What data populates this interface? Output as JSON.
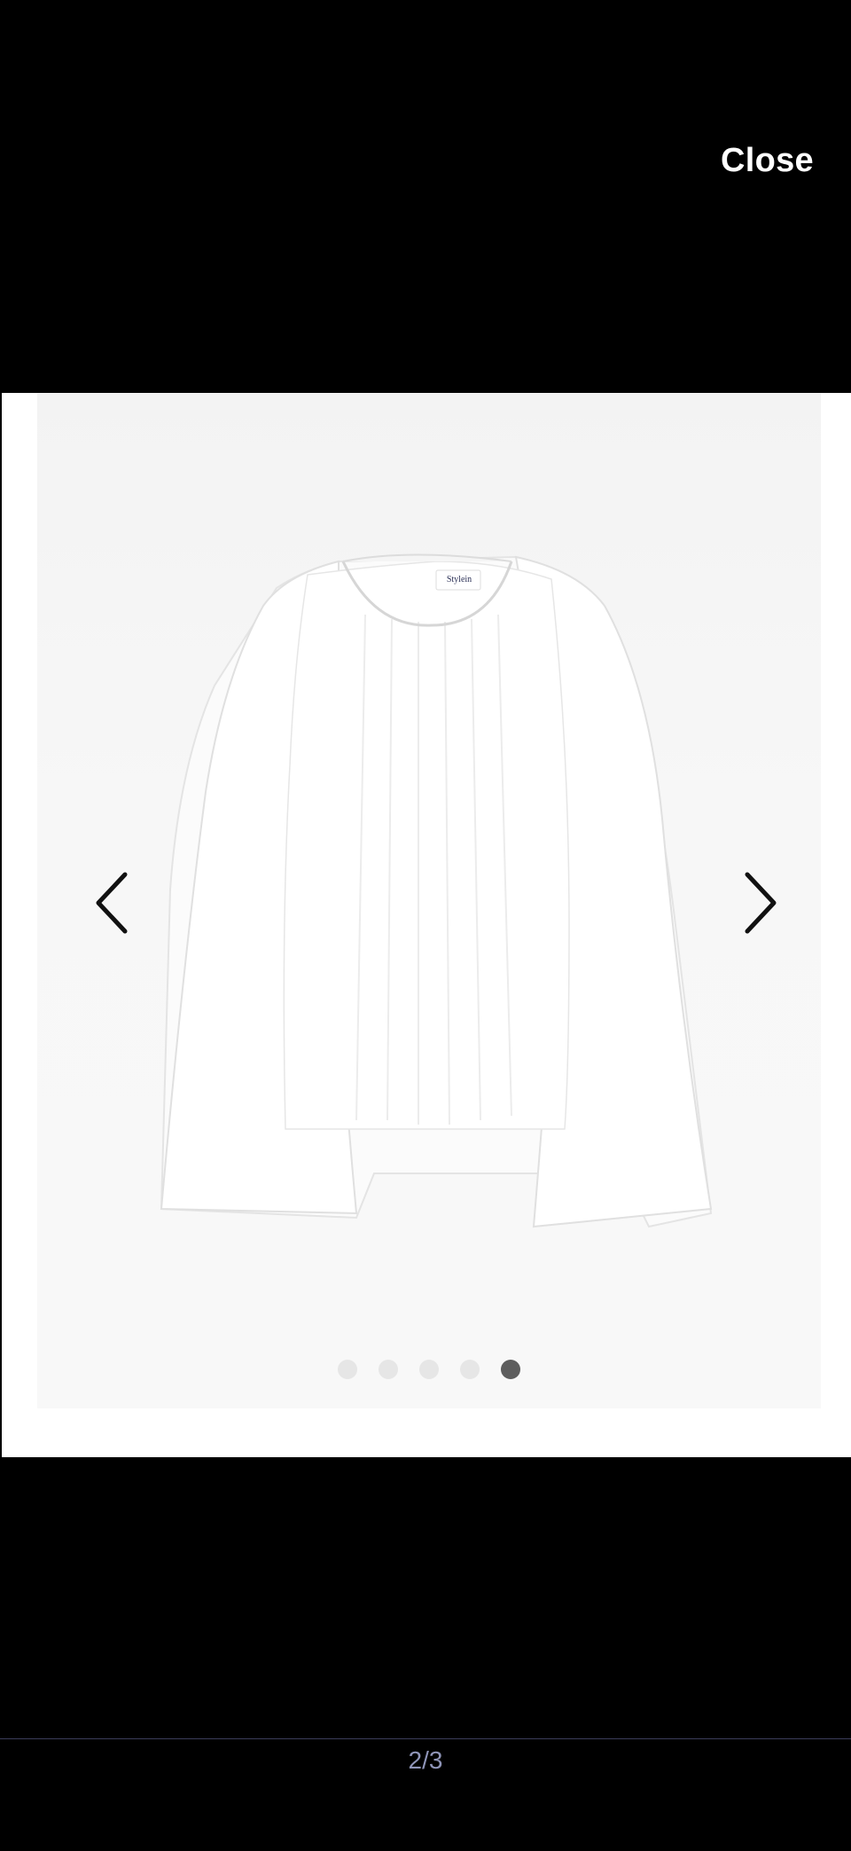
{
  "header": {
    "close_label": "Close"
  },
  "gallery": {
    "image_label_text": "Stylein",
    "prev_icon": "chevron-left-icon",
    "next_icon": "chevron-right-icon",
    "dots": [
      {
        "active": false
      },
      {
        "active": false
      },
      {
        "active": false
      },
      {
        "active": false
      },
      {
        "active": true
      }
    ]
  },
  "footer": {
    "counter": "2/3"
  },
  "colors": {
    "background": "#000000",
    "panel": "#ffffff",
    "dot_inactive": "#e6e6e6",
    "dot_active": "#5e5e5e",
    "counter_text": "#8f95b8"
  }
}
